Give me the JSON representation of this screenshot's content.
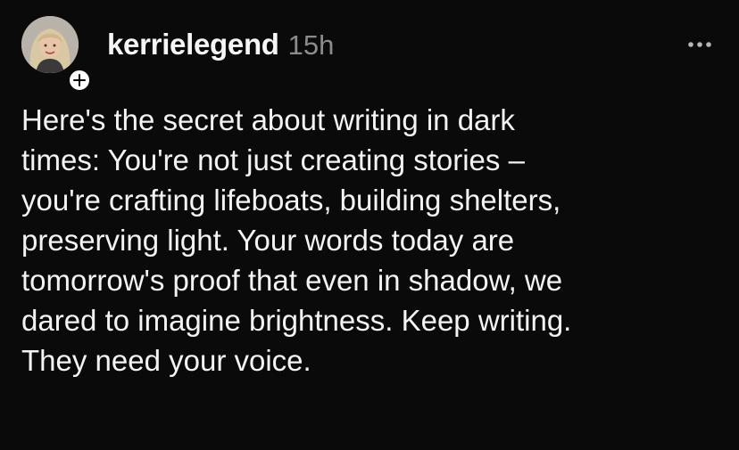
{
  "post": {
    "username": "kerrielegend",
    "timestamp": "15h",
    "text": "Here's the secret about writing in dark\ntimes: You're not just creating stories –\nyou're crafting lifeboats, building shelters,\npreserving light. Your words today are\ntomorrow's proof that even in shadow, we\ndared to imagine brightness. Keep writing.\nThey need your voice."
  },
  "icons": {
    "follow": "plus-icon",
    "more": "more-horizontal-icon"
  },
  "colors": {
    "background": "#0a0a0a",
    "text": "#f3f3f3",
    "muted": "#8c8c8c"
  }
}
